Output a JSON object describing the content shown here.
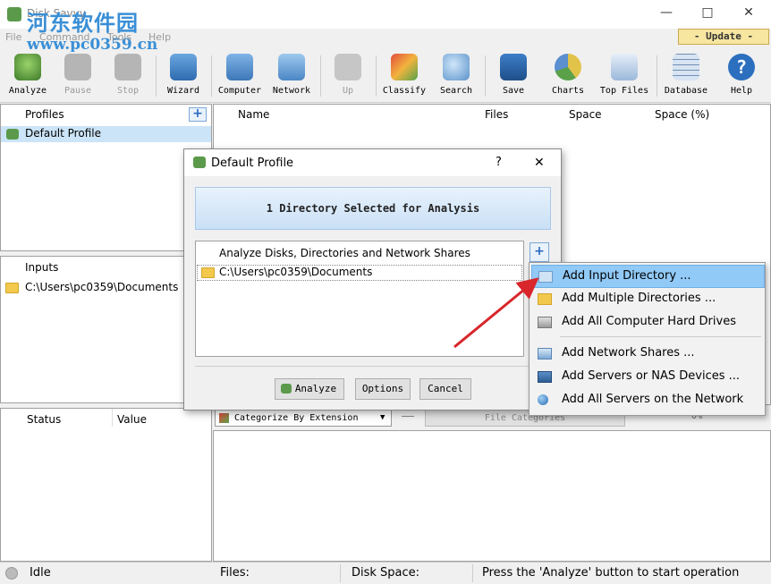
{
  "window": {
    "title": "Disk Savvy"
  },
  "watermark": {
    "line1": "河东软件园",
    "line2": "www.pc0359.cn"
  },
  "menu": [
    "File",
    "Command",
    "Tools",
    "Help"
  ],
  "update_label": "Update",
  "toolbar": [
    {
      "label": "Analyze",
      "icon": "analyze-icon",
      "enabled": true
    },
    {
      "label": "Pause",
      "icon": "pause-icon",
      "enabled": false
    },
    {
      "label": "Stop",
      "icon": "stop-icon",
      "enabled": false
    },
    {
      "label": "Wizard",
      "icon": "wizard-icon",
      "enabled": true
    },
    {
      "label": "Computer",
      "icon": "computer-icon",
      "enabled": true
    },
    {
      "label": "Network",
      "icon": "network-icon",
      "enabled": true
    },
    {
      "label": "Up",
      "icon": "up-arrow-icon",
      "enabled": false
    },
    {
      "label": "Classify",
      "icon": "classify-icon",
      "enabled": true
    },
    {
      "label": "Search",
      "icon": "search-icon",
      "enabled": true
    },
    {
      "label": "Save",
      "icon": "save-icon",
      "enabled": true
    },
    {
      "label": "Charts",
      "icon": "charts-icon",
      "enabled": true
    },
    {
      "label": "Top Files",
      "icon": "top-files-icon",
      "enabled": true
    },
    {
      "label": "Database",
      "icon": "database-icon",
      "enabled": true
    },
    {
      "label": "Help",
      "icon": "help-icon",
      "enabled": true
    }
  ],
  "profiles": {
    "header": "Profiles",
    "items": [
      "Default Profile"
    ]
  },
  "inputs": {
    "header": "Inputs",
    "items": [
      "C:\\Users\\pc0359\\Documents"
    ]
  },
  "status_panel": {
    "col1": "Status",
    "col2": "Value"
  },
  "results_table": {
    "columns": [
      "Name",
      "Files",
      "Space",
      "Space (%)"
    ]
  },
  "categorize": {
    "selected": "Categorize By Extension",
    "header": "File Categories",
    "percent": "0%"
  },
  "dialog": {
    "title": "Default Profile",
    "help": "?",
    "close": "✕",
    "banner": "1 Directory Selected for Analysis",
    "list_header": "Analyze Disks, Directories and Network Shares",
    "list_items": [
      "C:\\Users\\pc0359\\Documents"
    ],
    "buttons": {
      "analyze": "Analyze",
      "options": "Options",
      "cancel": "Cancel"
    }
  },
  "add_menu": [
    {
      "label": "Add Input Directory ...",
      "icon": "folder-icon",
      "highlighted": true
    },
    {
      "label": "Add Multiple Directories ...",
      "icon": "folders-icon",
      "highlighted": false
    },
    {
      "label": "Add All Computer Hard Drives",
      "icon": "hard-drive-icon",
      "highlighted": false
    },
    {
      "label": "Add Network Shares ...",
      "icon": "network-share-icon",
      "highlighted": false
    },
    {
      "label": "Add Servers or NAS Devices ...",
      "icon": "server-icon",
      "highlighted": false
    },
    {
      "label": "Add All Servers on the Network",
      "icon": "globe-icon",
      "highlighted": false
    }
  ],
  "statusbar": {
    "state": "Idle",
    "files_label": "Files:",
    "space_label": "Disk Space:",
    "message": "Press the 'Analyze' button to start operation"
  }
}
